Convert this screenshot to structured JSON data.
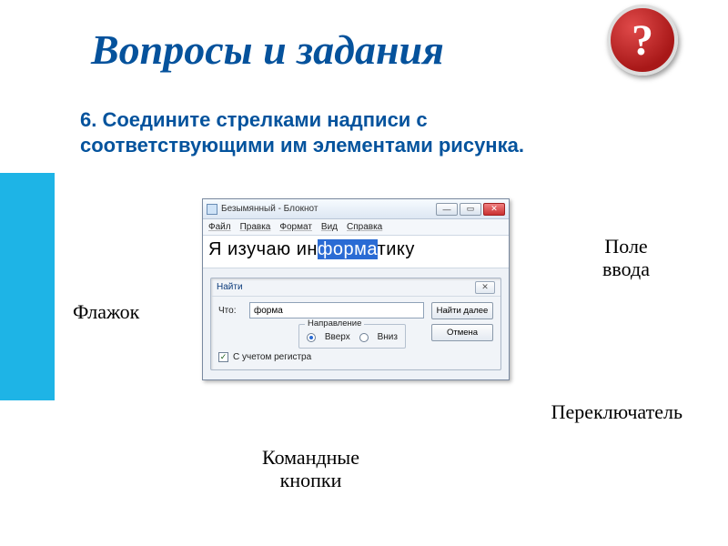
{
  "title": "Вопросы и задания",
  "help_symbol": "?",
  "instruction": "6. Соедините стрелками надписи с соответствующими им элементами рисунка.",
  "labels": {
    "flag": "Флажок",
    "input_field_l1": "Поле",
    "input_field_l2": "ввода",
    "switch": "Переключатель",
    "cmd_l1": "Командные",
    "cmd_l2": "кнопки"
  },
  "notepad": {
    "window_title": "Безымянный - Блокнот",
    "menu": {
      "file": "Файл",
      "edit": "Правка",
      "format": "Формат",
      "view": "Вид",
      "help": "Справка"
    },
    "text_before": "Я изучаю ин",
    "text_sel": "форма",
    "text_after": "тику",
    "winbtn_min": "—",
    "winbtn_max": "▭",
    "winbtn_close": "✕"
  },
  "find": {
    "title": "Найти",
    "what_label": "Что:",
    "what_value": "форма",
    "btn_next": "Найти далее",
    "btn_cancel": "Отмена",
    "group_title": "Направление",
    "radio_up": "Вверх",
    "radio_down": "Вниз",
    "radio_selected": "up",
    "checkbox_label": "С учетом регистра",
    "checkbox_checked": true,
    "close_symbol": "✕"
  }
}
